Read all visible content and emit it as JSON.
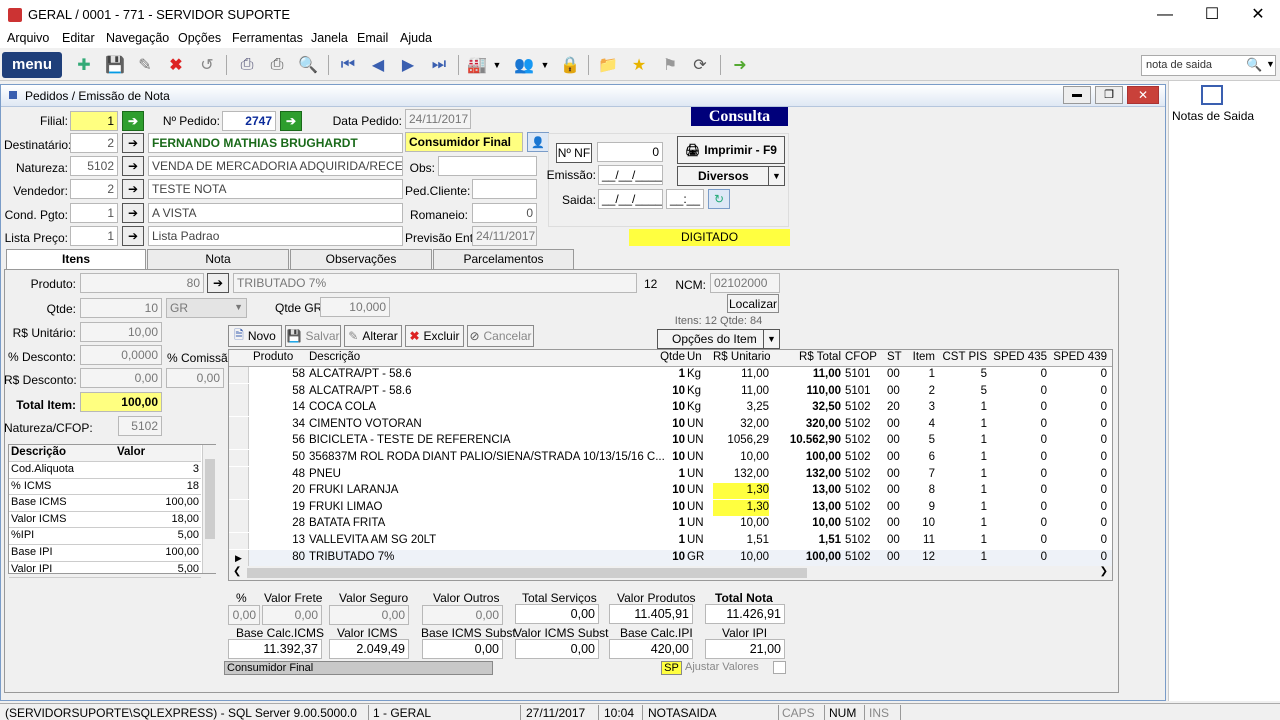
{
  "window": {
    "title": "GERAL / 0001 - 771 - SERVIDOR SUPORTE"
  },
  "menu": [
    "Arquivo",
    "Editar",
    "Navegação",
    "Opções",
    "Ferramentas",
    "Janela",
    "Email",
    "Ajuda"
  ],
  "toolbar": {
    "menu_label": "menu",
    "search_value": "nota de saida"
  },
  "right_panel": {
    "label": "Notas de Saida"
  },
  "child": {
    "title": "Pedidos / Emissão de Nota",
    "status_banner": "Consulta",
    "situacao": "DIGITADO"
  },
  "form": {
    "filial_label": "Filial:",
    "filial": "1",
    "pedido_label": "Nº Pedido:",
    "pedido": "2747",
    "data_pedido_label": "Data Pedido:",
    "data_pedido": "24/11/2017",
    "destinatario_label": "Destinatário:",
    "destinatario_cod": "2",
    "destinatario_nome": "FERNANDO MATHIAS BRUGHARDT",
    "consumidor": "Consumidor Final",
    "natureza_label": "Natureza:",
    "natureza_cod": "5102",
    "natureza_desc": "VENDA DE MERCADORIA ADQUIRIDA/RECEBIDA",
    "obs_label": "Obs:",
    "vendedor_label": "Vendedor:",
    "vendedor_cod": "2",
    "vendedor_nome": "TESTE NOTA",
    "pedcliente_label": "Ped.Cliente:",
    "condpgto_label": "Cond. Pgto:",
    "condpgto_cod": "1",
    "condpgto_desc": "A VISTA",
    "romaneio_label": "Romaneio:",
    "romaneio": "0",
    "listapreco_label": "Lista Preço:",
    "listapreco_cod": "1",
    "listapreco_desc": "Lista Padrao",
    "previsao_label": "Previsão Ent:",
    "previsao": "24/11/2017",
    "nnf_label": "Nº NF",
    "nnf": "0",
    "emissao_label": "Emissão:",
    "emissao": "__/__/____",
    "saida_label": "Saida:",
    "saida_data": "__/__/____",
    "saida_hora": "__:__",
    "imprimir": "Imprimir - F9",
    "diversos": "Diversos"
  },
  "tabs": [
    "Itens",
    "Nota",
    "Observações",
    "Parcelamentos"
  ],
  "item": {
    "produto_label": "Produto:",
    "produto_cod": "80",
    "produto_desc": "TRIBUTADO 7%",
    "produto_num": "12",
    "ncm_label": "NCM:",
    "ncm": "02102000",
    "localizar": "Localizar",
    "qtde_label": "Qtde:",
    "qtde": "10",
    "unidade": "GR",
    "qtdegr_label": "Qtde GR",
    "qtdegr": "10,000",
    "itens_info": "Itens: 12  Qtde: 84",
    "unitario_label": "R$ Unitário:",
    "unitario": "10,00",
    "desconto_pct_label": "% Desconto:",
    "desconto_pct": "0,0000",
    "comissao_label": "% Comissão",
    "comissao": "0,00",
    "desconto_val_label": "R$ Desconto:",
    "desconto_val": "0,00",
    "total_label": "Total Item:",
    "total": "100,00",
    "natcfop_label": "Natureza/CFOP:",
    "natcfop": "5102",
    "opcoes": "Opções do Item"
  },
  "actions": {
    "novo": "Novo",
    "salvar": "Salvar",
    "alterar": "Alterar",
    "excluir": "Excluir",
    "cancelar": "Cancelar"
  },
  "props": {
    "headers": [
      "Descrição",
      "Valor"
    ],
    "rows": [
      [
        "Cod.Aliquota",
        "3"
      ],
      [
        "% ICMS",
        "18"
      ],
      [
        "Base ICMS",
        "100,00"
      ],
      [
        "Valor ICMS",
        "18,00"
      ],
      [
        "%IPI",
        "5,00"
      ],
      [
        "Base IPI",
        "100,00"
      ],
      [
        "Valor IPI",
        "5,00"
      ]
    ]
  },
  "grid": {
    "headers": [
      "Produto",
      "Descrição",
      "Qtde",
      "Un",
      "R$ Unitario",
      "R$ Total",
      "CFOP",
      "ST",
      "Item",
      "CST PIS",
      "SPED 435",
      "SPED 439"
    ],
    "rows": [
      [
        "58",
        "ALCATRA/PT - 58.6",
        "1",
        "Kg",
        "11,00",
        "11,00",
        "5101",
        "00",
        "1",
        "5",
        "0",
        "0"
      ],
      [
        "58",
        "ALCATRA/PT - 58.6",
        "10",
        "Kg",
        "11,00",
        "110,00",
        "5101",
        "00",
        "2",
        "5",
        "0",
        "0"
      ],
      [
        "14",
        "COCA COLA",
        "10",
        "Kg",
        "3,25",
        "32,50",
        "5102",
        "20",
        "3",
        "1",
        "0",
        "0"
      ],
      [
        "34",
        "CIMENTO VOTORAN",
        "10",
        "UN",
        "32,00",
        "320,00",
        "5102",
        "00",
        "4",
        "1",
        "0",
        "0"
      ],
      [
        "56",
        "BICICLETA - TESTE DE REFERENCIA",
        "10",
        "UN",
        "1056,29",
        "10.562,90",
        "5102",
        "00",
        "5",
        "1",
        "0",
        "0"
      ],
      [
        "50",
        "356837M ROL RODA DIANT PALIO/SIENA/STRADA 10/13/15/16 C...",
        "10",
        "UN",
        "10,00",
        "100,00",
        "5102",
        "00",
        "6",
        "1",
        "0",
        "0"
      ],
      [
        "48",
        "PNEU",
        "1",
        "UN",
        "132,00",
        "132,00",
        "5102",
        "00",
        "7",
        "1",
        "0",
        "0"
      ],
      [
        "20",
        "FRUKI LARANJA",
        "10",
        "UN",
        "1,30",
        "13,00",
        "5102",
        "00",
        "8",
        "1",
        "0",
        "0"
      ],
      [
        "19",
        "FRUKI LIMAO",
        "10",
        "UN",
        "1,30",
        "13,00",
        "5102",
        "00",
        "9",
        "1",
        "0",
        "0"
      ],
      [
        "28",
        "BATATA FRITA",
        "1",
        "UN",
        "10,00",
        "10,00",
        "5102",
        "00",
        "10",
        "1",
        "0",
        "0"
      ],
      [
        "13",
        "VALLEVITA AM SG 20LT",
        "1",
        "UN",
        "1,51",
        "1,51",
        "5102",
        "00",
        "11",
        "1",
        "0",
        "0"
      ],
      [
        "80",
        "TRIBUTADO 7%",
        "10",
        "GR",
        "10,00",
        "100,00",
        "5102",
        "00",
        "12",
        "1",
        "0",
        "0"
      ]
    ]
  },
  "totals": {
    "pct_label": "%",
    "frete_label": "Valor Frete",
    "pct": "0,00",
    "frete": "0,00",
    "seguro_label": "Valor Seguro",
    "seguro": "0,00",
    "outros_label": "Valor Outros",
    "outros": "0,00",
    "servicos_label": "Total Serviços",
    "servicos": "0,00",
    "produtos_label": "Valor Produtos",
    "produtos": "11.405,91",
    "nota_label": "Total Nota",
    "nota": "11.426,91",
    "basecalc_label": "Base Calc.ICMS",
    "basecalc": "11.392,37",
    "icms_label": "Valor ICMS",
    "icms": "2.049,49",
    "basesubst_label": "Base ICMS Subst",
    "basesubst": "0,00",
    "icmssubst_label": "Valor ICMS Subst",
    "icmssubst": "0,00",
    "baseipi_label": "Base Calc.IPI",
    "baseipi": "420,00",
    "ipi_label": "Valor IPI",
    "ipi": "21,00",
    "consumidor": "Consumidor Final",
    "uf": "SP",
    "ajustar": "Ajustar Valores"
  },
  "status": {
    "server": "(SERVIDORSUPORTE\\SQLEXPRESS) - SQL Server 9.00.5000.0",
    "empresa": "1 - GERAL",
    "data": "27/11/2017",
    "hora": "10:04",
    "modulo": "NOTASAIDA",
    "caps": "CAPS",
    "num": "NUM",
    "ins": "INS"
  }
}
